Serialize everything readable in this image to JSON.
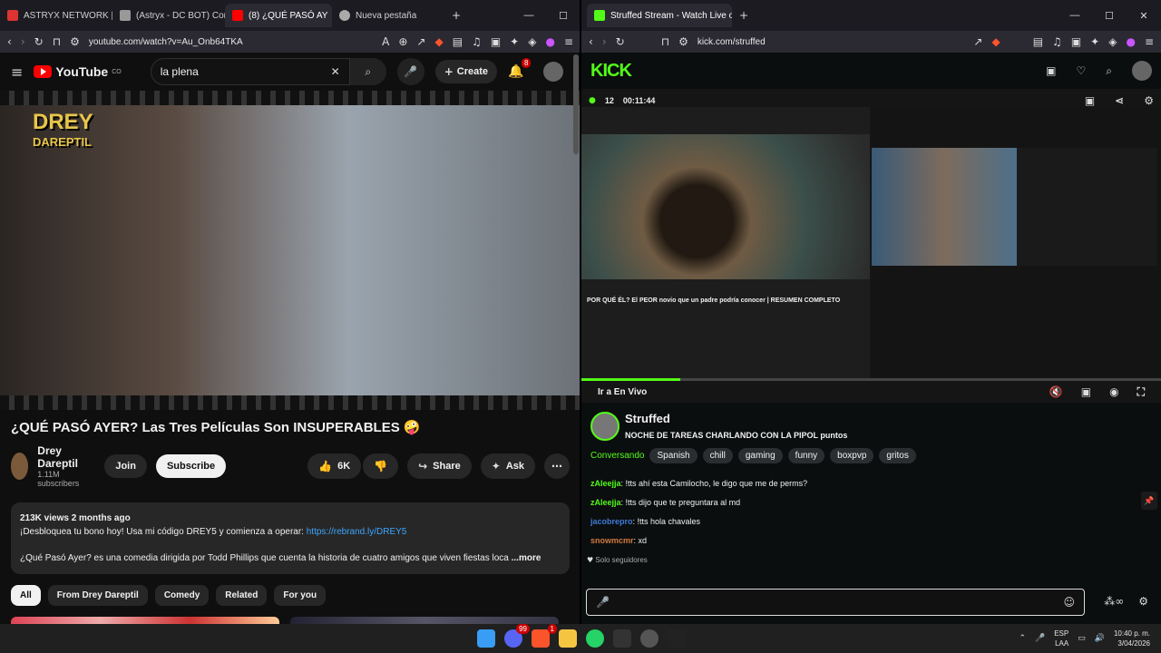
{
  "left_window": {
    "tabs": [
      {
        "label": "ASTRYX NETWORK | Web",
        "color": "#d33"
      },
      {
        "label": "(Astryx - DC BOT) Consol",
        "color": "#999"
      },
      {
        "label": "(8) ¿QUÉ PASÓ AY",
        "color": "#ff0000",
        "active": true
      },
      {
        "label": "Nueva pestaña",
        "color": "#aaa"
      }
    ],
    "url": "youtube.com/watch?v=Au_Onb64TKA",
    "header": {
      "logo_text": "YouTube",
      "country": "CO",
      "search_value": "la plena",
      "create_label": "Create",
      "notifications": "8"
    },
    "video": {
      "overlay_text_1": "DREY",
      "overlay_text_2": "DAREPTIL",
      "title": "¿QUÉ PASÓ AYER? Las Tres Películas Son INSUPERABLES 🤪",
      "channel": "Drey Dareptil",
      "subscribers": "1.11M subscribers",
      "join_label": "Join",
      "subscribe_label": "Subscribe",
      "likes": "6K",
      "share_label": "Share",
      "ask_label": "Ask"
    },
    "description": {
      "stats": "213K views  2 months ago",
      "line1": "¡Desbloquea tu bono hoy! Usa mi código DREY5 y comienza a operar: ",
      "link": "https://rebrand.ly/DREY5",
      "line2": "¿Qué Pasó Ayer? es una comedia dirigida por Todd Phillips que cuenta la historia de cuatro amigos que viven fiestas loca",
      "more": "...more"
    },
    "chips": [
      "All",
      "From Drey Dareptil",
      "Comedy",
      "Related",
      "For you"
    ]
  },
  "right_window": {
    "tab": {
      "label": "Struffed Stream - Watch Live on"
    },
    "url": "kick.com/struffed",
    "logo": "KICK",
    "stream": {
      "viewers": "12",
      "duration": "00:11:44",
      "go_live": "Ir a En Vivo",
      "progress": 0.17,
      "inner_title": "POR QUÉ ÉL? El PEOR novio que un padre podría conocer | RESUMEN COMPLETO"
    },
    "channel": {
      "name": "Struffed",
      "title": "NOCHE DE TAREAS CHARLANDO CON LA PIPOL  puntos",
      "category": "Conversando",
      "tags": [
        "Spanish",
        "chill",
        "gaming",
        "funny",
        "boxpvp",
        "gritos"
      ]
    },
    "chat": [
      {
        "user": "zAleejja",
        "msg": ": !tts ahí esta Camilocho, le digo que me de perms?",
        "cls": "u1"
      },
      {
        "user": "zAleejja",
        "msg": ": !tts dijo que te preguntara al md",
        "cls": "u1"
      },
      {
        "user": "jacobrepro",
        "msg": ": !tts hola chavales",
        "cls": "u2"
      },
      {
        "user": "snowmcmr",
        "msg": ": xd",
        "cls": "u3"
      }
    ],
    "followers_only": "Solo seguidores"
  },
  "taskbar": {
    "lang": "ESP",
    "region": "LAA",
    "time": "10:40 p. m.",
    "date": "3/04/2026",
    "discord_badge": "99",
    "brave_badge": "1"
  }
}
